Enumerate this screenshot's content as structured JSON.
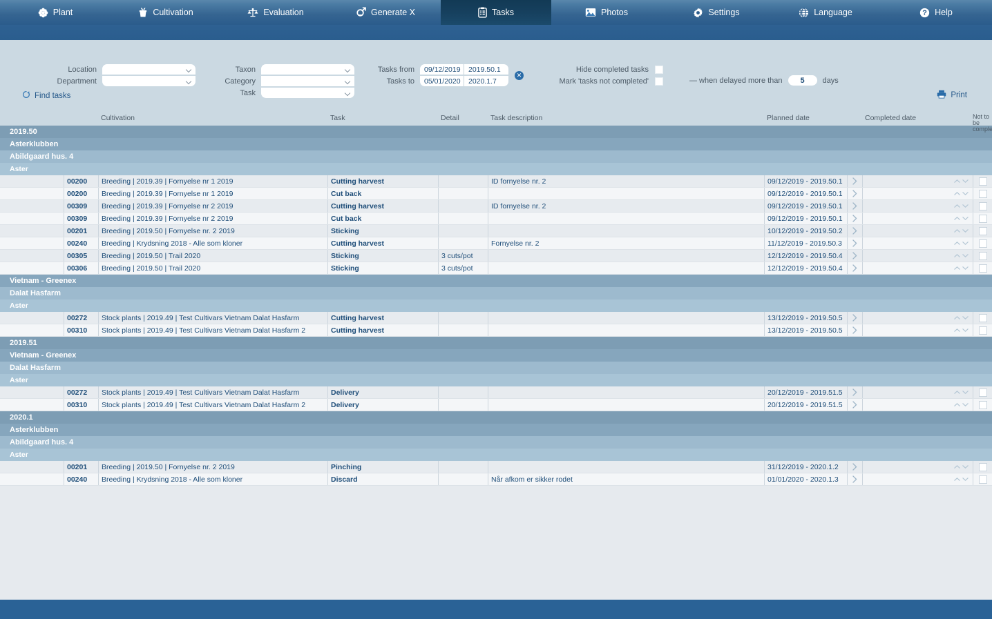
{
  "nav": {
    "items": [
      {
        "label": "Plant",
        "icon": "flower-icon",
        "active": false
      },
      {
        "label": "Cultivation",
        "icon": "pot-plant-icon",
        "active": false
      },
      {
        "label": "Evaluation",
        "icon": "scales-icon",
        "active": false
      },
      {
        "label": "Generate X",
        "icon": "gender-cross-icon",
        "active": false
      },
      {
        "label": "Tasks",
        "icon": "clipboard-icon",
        "active": true
      },
      {
        "label": "Photos",
        "icon": "photo-icon",
        "active": false
      },
      {
        "label": "Settings",
        "icon": "gear-icon",
        "active": false
      },
      {
        "label": "Language",
        "icon": "globe-icon",
        "active": false
      },
      {
        "label": "Help",
        "icon": "question-mark-icon",
        "active": false
      }
    ]
  },
  "toolbar": {
    "find_tasks_label": "Find tasks",
    "find_tasks_icon": "refresh-icon",
    "print_label": "Print",
    "print_icon": "printer-icon"
  },
  "filters": {
    "location_label": "Location",
    "location_value": "",
    "department_label": "Department",
    "department_value": "",
    "taxon_label": "Taxon",
    "taxon_value": "",
    "category_label": "Category",
    "category_value": "",
    "task_label": "Task",
    "task_value": "",
    "tasks_from_label": "Tasks from",
    "tasks_from_date": "09/12/2019",
    "tasks_from_week": "2019.50.1",
    "tasks_to_label": "Tasks to",
    "tasks_to_date": "05/01/2020",
    "tasks_to_week": "2020.1.7",
    "clear_icon": "clear-circle-icon",
    "clear_glyph": "✕",
    "hide_completed_label": "Hide completed tasks",
    "hide_completed_checked": false,
    "mark_not_completed_label": "Mark 'tasks not completed'",
    "mark_not_completed_checked": false,
    "delay_prefix": "— when delayed more than",
    "delay_days": "5",
    "delay_suffix": "days"
  },
  "table": {
    "headers": {
      "cultivation": "Cultivation",
      "task": "Task",
      "detail": "Detail",
      "description": "Task description",
      "planned": "Planned date",
      "completed": "Completed date",
      "not_to_be_completed_1": "Not to be",
      "not_to_be_completed_2": "completed"
    },
    "groups": [
      {
        "level0": "2019.50",
        "blocks": [
          {
            "level1": "Asterklubben",
            "level2": "Abildgaard hus. 4",
            "level3": "Aster",
            "rows": [
              {
                "id": "00200",
                "cultivation": "Breeding  |  2019.39  |  Fornyelse nr 1 2019",
                "task": "Cutting harvest",
                "detail": "",
                "description": "ID  fornyelse nr. 2",
                "planned": "09/12/2019 - 2019.50.1",
                "completed": ""
              },
              {
                "id": "00200",
                "cultivation": "Breeding  |  2019.39  |  Fornyelse nr 1 2019",
                "task": "Cut back",
                "detail": "",
                "description": "",
                "planned": "09/12/2019 - 2019.50.1",
                "completed": ""
              },
              {
                "id": "00309",
                "cultivation": "Breeding  |  2019.39  |  Fornyelse nr 2 2019",
                "task": "Cutting harvest",
                "detail": "",
                "description": "ID  fornyelse nr. 2",
                "planned": "09/12/2019 - 2019.50.1",
                "completed": ""
              },
              {
                "id": "00309",
                "cultivation": "Breeding  |  2019.39  |  Fornyelse nr 2 2019",
                "task": "Cut back",
                "detail": "",
                "description": "",
                "planned": "09/12/2019 - 2019.50.1",
                "completed": ""
              },
              {
                "id": "00201",
                "cultivation": "Breeding  |  2019.50  |  Fornyelse nr. 2 2019",
                "task": "Sticking",
                "detail": "",
                "description": "",
                "planned": "10/12/2019 - 2019.50.2",
                "completed": ""
              },
              {
                "id": "00240",
                "cultivation": "Breeding  |  Krydsning 2018 - Alle som kloner",
                "task": "Cutting harvest",
                "detail": "",
                "description": "Fornyelse nr. 2",
                "planned": "11/12/2019 - 2019.50.3",
                "completed": ""
              },
              {
                "id": "00305",
                "cultivation": "Breeding  |  2019.50  |  Trail 2020",
                "task": "Sticking",
                "detail": "3 cuts/pot",
                "description": "",
                "planned": "12/12/2019 - 2019.50.4",
                "completed": ""
              },
              {
                "id": "00306",
                "cultivation": "Breeding  |  2019.50  |  Trail 2020",
                "task": "Sticking",
                "detail": "3 cuts/pot",
                "description": "",
                "planned": "12/12/2019 - 2019.50.4",
                "completed": ""
              }
            ]
          },
          {
            "level1": "Vietnam - Greenex",
            "level2": "Dalat Hasfarm",
            "level3": "Aster",
            "rows": [
              {
                "id": "00272",
                "cultivation": "Stock plants  |  2019.49  |  Test Cultivars Vietnam Dalat Hasfarm",
                "task": "Cutting harvest",
                "detail": "",
                "description": "",
                "planned": "13/12/2019 - 2019.50.5",
                "completed": ""
              },
              {
                "id": "00310",
                "cultivation": "Stock plants  |  2019.49  |  Test Cultivars Vietnam Dalat Hasfarm 2",
                "task": "Cutting harvest",
                "detail": "",
                "description": "",
                "planned": "13/12/2019 - 2019.50.5",
                "completed": ""
              }
            ]
          }
        ]
      },
      {
        "level0": "2019.51",
        "blocks": [
          {
            "level1": "Vietnam - Greenex",
            "level2": "Dalat Hasfarm",
            "level3": "Aster",
            "rows": [
              {
                "id": "00272",
                "cultivation": "Stock plants  |  2019.49  |  Test Cultivars Vietnam Dalat Hasfarm",
                "task": "Delivery",
                "detail": "",
                "description": "",
                "planned": "20/12/2019 - 2019.51.5",
                "completed": ""
              },
              {
                "id": "00310",
                "cultivation": "Stock plants  |  2019.49  |  Test Cultivars Vietnam Dalat Hasfarm 2",
                "task": "Delivery",
                "detail": "",
                "description": "",
                "planned": "20/12/2019 - 2019.51.5",
                "completed": ""
              }
            ]
          }
        ]
      },
      {
        "level0": "2020.1",
        "blocks": [
          {
            "level1": "Asterklubben",
            "level2": "Abildgaard hus. 4",
            "level3": "Aster",
            "rows": [
              {
                "id": "00201",
                "cultivation": "Breeding  |  2019.50  |  Fornyelse nr. 2 2019",
                "task": "Pinching",
                "detail": "",
                "description": "",
                "planned": "31/12/2019 - 2020.1.2",
                "completed": ""
              },
              {
                "id": "00240",
                "cultivation": "Breeding  |  Krydsning 2018 - Alle som kloner",
                "task": "Discard",
                "detail": "",
                "description": "Når afkom er sikker rodet",
                "planned": "01/01/2020 - 2020.1.3",
                "completed": ""
              }
            ]
          }
        ]
      }
    ]
  },
  "colors": {
    "nav_active": "#16405e",
    "accent": "#2a6ca8",
    "panel": "#cbd9e2",
    "bottom_bar": "#2a6296"
  }
}
